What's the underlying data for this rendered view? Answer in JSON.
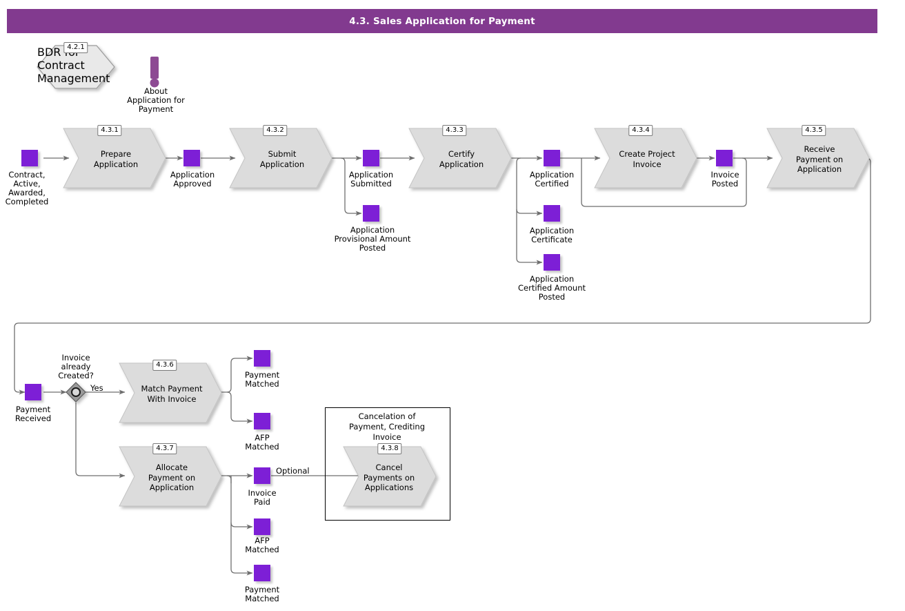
{
  "header": {
    "title": "4.3. Sales Application for Payment",
    "bg_color": "#823a8f",
    "text_color": "#ffffff"
  },
  "colors": {
    "event_purple": "#7d1fd6",
    "activity_gray": "#dcdcdc",
    "activity_border": "#9a9a9a",
    "connector": "#6e6e6e",
    "annotation_purple": "#8d4a93",
    "gateway_fill": "#9a9a9a"
  },
  "diagram": {
    "type": "process-flow",
    "annotation": {
      "icon": "exclamation-icon",
      "label": "About\nApplication for\nPayment"
    },
    "linked_process": {
      "tag": "4.2.1",
      "label": "BDR for\nContract\nManagement",
      "shape": "hexagon"
    },
    "activities": [
      {
        "tag": "4.3.1",
        "label": "Prepare\nApplication"
      },
      {
        "tag": "4.3.2",
        "label": "Submit\nApplication"
      },
      {
        "tag": "4.3.3",
        "label": "Certify\nApplication"
      },
      {
        "tag": "4.3.4",
        "label": "Create Project\nInvoice"
      },
      {
        "tag": "4.3.5",
        "label": "Receive\nPayment on\nApplication"
      },
      {
        "tag": "4.3.6",
        "label": "Match Payment\nWith Invoice"
      },
      {
        "tag": "4.3.7",
        "label": "Allocate\nPayment on\nApplication"
      },
      {
        "tag": "4.3.8",
        "label": "Cancel\nPayments on\nApplications"
      }
    ],
    "events": [
      {
        "id": "start",
        "label": "Contract,\nActive,\nAwarded,\nCompleted"
      },
      {
        "id": "app-approved",
        "label": "Application\nApproved"
      },
      {
        "id": "app-submitted",
        "label": "Application\nSubmitted"
      },
      {
        "id": "app-prov-amount",
        "label": "Application\nProvisional Amount\nPosted"
      },
      {
        "id": "app-certified",
        "label": "Application\nCertified"
      },
      {
        "id": "app-certificate",
        "label": "Application\nCertificate"
      },
      {
        "id": "app-cert-amount",
        "label": "Application\nCertified Amount\nPosted"
      },
      {
        "id": "invoice-posted",
        "label": "Invoice\nPosted"
      },
      {
        "id": "payment-received",
        "label": "Payment\nReceived"
      },
      {
        "id": "payment-matched-1",
        "label": "Payment\nMatched"
      },
      {
        "id": "afp-matched-1",
        "label": "AFP\nMatched"
      },
      {
        "id": "invoice-paid",
        "label": "Invoice\nPaid"
      },
      {
        "id": "afp-matched-2",
        "label": "AFP\nMatched"
      },
      {
        "id": "payment-matched-2",
        "label": "Payment\nMatched"
      }
    ],
    "gateway": {
      "id": "invoice-created-gateway",
      "question": "Invoice\nalready\nCreated?",
      "yes_label": "Yes"
    },
    "flow_labels": [
      {
        "id": "optional",
        "label": "Optional"
      }
    ],
    "group": {
      "title": "Cancelation of\nPayment, Crediting\nInvoice"
    }
  }
}
